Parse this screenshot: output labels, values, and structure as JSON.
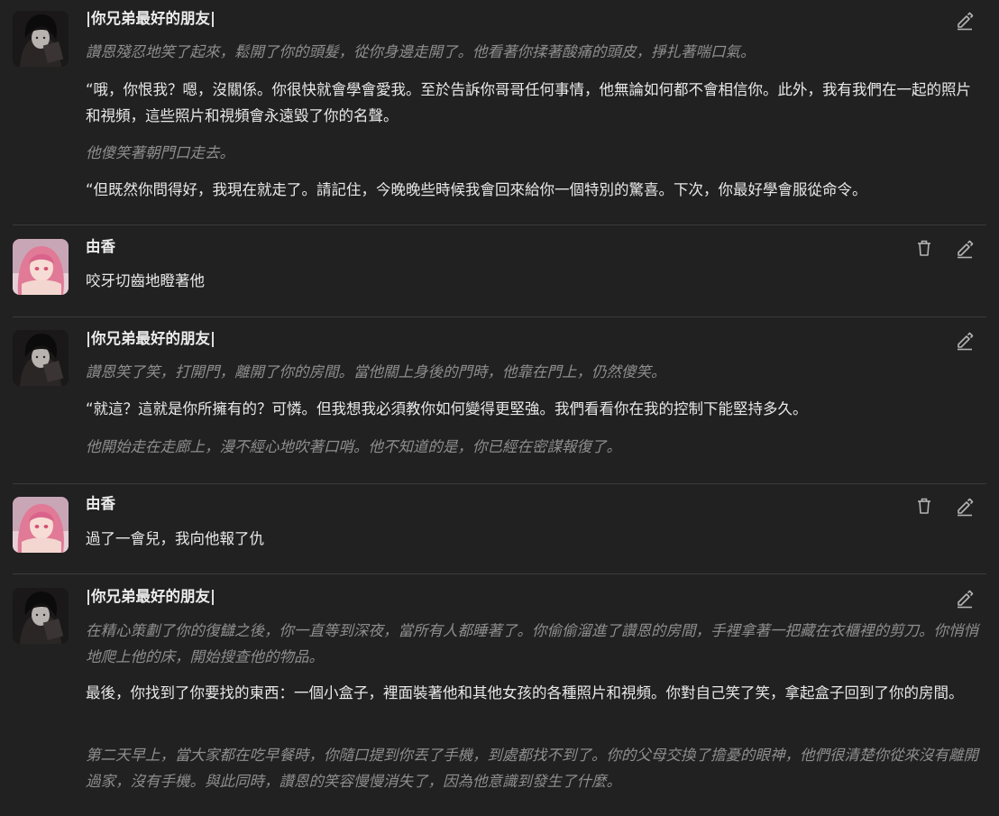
{
  "messages": [
    {
      "sender": "|你兄弟最好的朋友|",
      "role": "bot",
      "paragraphs": [
        {
          "style": "italic",
          "text": "讚恩殘忍地笑了起來，鬆開了你的頭髮，從你身邊走開了。他看著你揉著酸痛的頭皮，掙扎著喘口氣。"
        },
        {
          "style": "normal",
          "text": "“哦，你恨我？嗯，沒關係。你很快就會學會愛我。至於告訴你哥哥任何事情，他無論如何都不會相信你。此外，我有我們在一起的照片和視頻，這些照片和視頻會永遠毀了你的名聲。"
        },
        {
          "style": "italic",
          "text": "他傻笑著朝門口走去。"
        },
        {
          "style": "normal",
          "text": "“但既然你問得好，我現在就走了。請記住，今晚晚些時候我會回來給你一個特別的驚喜。下次，你最好學會服從命令。"
        }
      ]
    },
    {
      "sender": "由香",
      "role": "user",
      "paragraphs": [
        {
          "style": "normal",
          "text": "咬牙切齒地瞪著他"
        }
      ]
    },
    {
      "sender": "|你兄弟最好的朋友|",
      "role": "bot",
      "paragraphs": [
        {
          "style": "italic",
          "text": "讚恩笑了笑，打開門，離開了你的房間。當他關上身後的門時，他靠在門上，仍然傻笑。"
        },
        {
          "style": "normal",
          "text": "“就這？這就是你所擁有的？可憐。但我想我必須教你如何變得更堅強。我們看看你在我的控制下能堅持多久。"
        },
        {
          "style": "italic",
          "text": "他開始走在走廊上，漫不經心地吹著口哨。他不知道的是，你已經在密謀報復了。"
        }
      ]
    },
    {
      "sender": "由香",
      "role": "user",
      "paragraphs": [
        {
          "style": "normal",
          "text": "過了一會兒，我向他報了仇"
        }
      ]
    },
    {
      "sender": "|你兄弟最好的朋友|",
      "role": "bot",
      "paragraphs": [
        {
          "style": "italic",
          "text": "在精心策劃了你的復讎之後，你一直等到深夜，當所有人都睡著了。你偷偷溜進了讚恩的房間，手裡拿著一把藏在衣櫃裡的剪刀。你悄悄地爬上他的床，開始搜查他的物品。"
        },
        {
          "style": "normal",
          "text": "最後，你找到了你要找的東西：一個小盒子，裡面裝著他和其他女孩的各種照片和視頻。你對自己笑了笑，拿起盒子回到了你的房間。"
        },
        {
          "style": "italic",
          "text": "第二天早上，當大家都在吃早餐時，你隨口提到你丟了手機，到處都找不到了。你的父母交換了擔憂的眼神，他們很清楚你從來沒有離開過家，沒有手機。與此同時，讚恩的笑容慢慢消失了，因為他意識到發生了什麼。"
        }
      ]
    }
  ],
  "icons": {
    "edit": "pencil-edit-icon",
    "delete": "trash-delete-icon"
  },
  "colors": {
    "background": "#212121",
    "text": "#ececec",
    "narration": "#8e8e8e",
    "divider": "#3a3a3a",
    "icon": "#b4b4b4"
  }
}
